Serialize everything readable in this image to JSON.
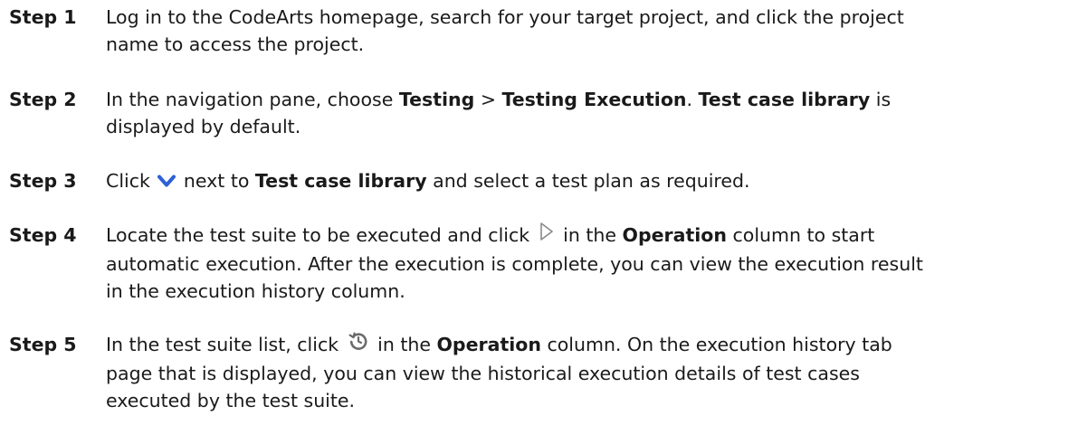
{
  "steps": [
    {
      "label": "Step 1",
      "text_1": "Log in to the CodeArts homepage, search for your target project, and click the project name to access the project."
    },
    {
      "label": "Step 2",
      "text_1": "In the navigation pane, choose ",
      "bold_1": "Testing",
      "text_2": " > ",
      "bold_2": "Testing Execution",
      "text_3": ". ",
      "bold_3": "Test case library",
      "text_4": " is displayed by default."
    },
    {
      "label": "Step 3",
      "text_1": "Click ",
      "icon": "chevron-down-icon",
      "text_2": " next to ",
      "bold_1": "Test case library",
      "text_3": " and select a test plan as required."
    },
    {
      "label": "Step 4",
      "text_1": "Locate the test suite to be executed and click ",
      "icon": "play-icon",
      "text_2": " in the ",
      "bold_1": "Operation",
      "text_3": " column to start automatic execution. After the execution is complete, you can view the execution result in the execution history column."
    },
    {
      "label": "Step 5",
      "text_1": "In the test suite list, click ",
      "icon": "history-icon",
      "text_2": " in the ",
      "bold_1": "Operation",
      "text_3": " column. On the execution history tab page that is displayed, you can view the historical execution details of test cases executed by the test suite."
    }
  ],
  "colors": {
    "text": "#1a1a1a",
    "chevron_icon": "#2e5fd6",
    "play_icon": "#8a8a8a",
    "history_icon": "#6b6b6b"
  }
}
